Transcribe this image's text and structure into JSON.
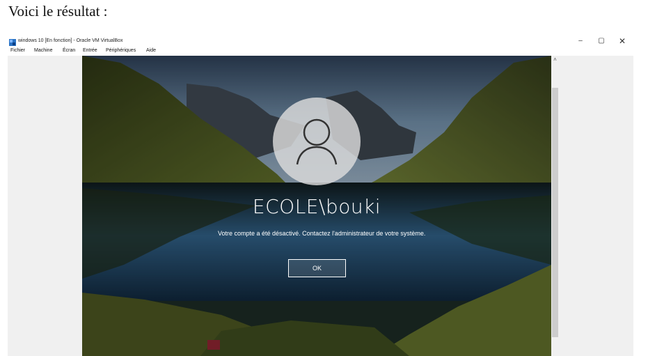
{
  "intro_text": "Voici le résultat :",
  "window": {
    "title": "windows 10 [En fonction] - Oracle VM VirtualBox",
    "controls": {
      "minimize": "–",
      "maximize": "▢",
      "close": "✕"
    }
  },
  "menu": [
    "Fichier",
    "Machine",
    "Écran",
    "Entrée",
    "Périphériques",
    "Aide"
  ],
  "login": {
    "username": "ECOLE\\bouki",
    "message": "Votre compte a été désactivé. Contactez l'administrateur de votre système.",
    "ok_label": "OK"
  },
  "icons": {
    "app": "virtualbox-icon",
    "avatar": "user-silhouette-icon",
    "scroll_up": "scroll-up-arrow-icon"
  },
  "scroll_up_glyph": "˄",
  "colors": {
    "accent": "#ffffff",
    "background": "#f0f0f0"
  }
}
